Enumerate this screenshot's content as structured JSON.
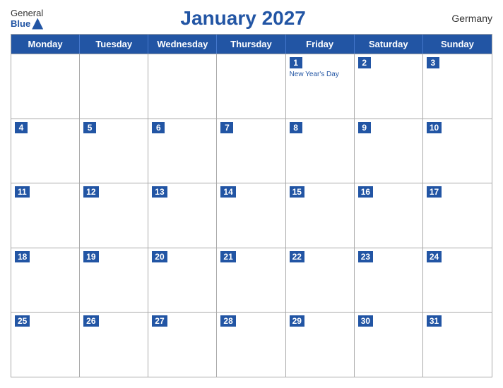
{
  "header": {
    "logo_general": "General",
    "logo_blue": "Blue",
    "title": "January 2027",
    "country": "Germany"
  },
  "days_of_week": [
    "Monday",
    "Tuesday",
    "Wednesday",
    "Thursday",
    "Friday",
    "Saturday",
    "Sunday"
  ],
  "weeks": [
    [
      {
        "num": "",
        "holiday": ""
      },
      {
        "num": "",
        "holiday": ""
      },
      {
        "num": "",
        "holiday": ""
      },
      {
        "num": "",
        "holiday": ""
      },
      {
        "num": "1",
        "holiday": "New Year's Day"
      },
      {
        "num": "2",
        "holiday": ""
      },
      {
        "num": "3",
        "holiday": ""
      }
    ],
    [
      {
        "num": "4",
        "holiday": ""
      },
      {
        "num": "5",
        "holiday": ""
      },
      {
        "num": "6",
        "holiday": ""
      },
      {
        "num": "7",
        "holiday": ""
      },
      {
        "num": "8",
        "holiday": ""
      },
      {
        "num": "9",
        "holiday": ""
      },
      {
        "num": "10",
        "holiday": ""
      }
    ],
    [
      {
        "num": "11",
        "holiday": ""
      },
      {
        "num": "12",
        "holiday": ""
      },
      {
        "num": "13",
        "holiday": ""
      },
      {
        "num": "14",
        "holiday": ""
      },
      {
        "num": "15",
        "holiday": ""
      },
      {
        "num": "16",
        "holiday": ""
      },
      {
        "num": "17",
        "holiday": ""
      }
    ],
    [
      {
        "num": "18",
        "holiday": ""
      },
      {
        "num": "19",
        "holiday": ""
      },
      {
        "num": "20",
        "holiday": ""
      },
      {
        "num": "21",
        "holiday": ""
      },
      {
        "num": "22",
        "holiday": ""
      },
      {
        "num": "23",
        "holiday": ""
      },
      {
        "num": "24",
        "holiday": ""
      }
    ],
    [
      {
        "num": "25",
        "holiday": ""
      },
      {
        "num": "26",
        "holiday": ""
      },
      {
        "num": "27",
        "holiday": ""
      },
      {
        "num": "28",
        "holiday": ""
      },
      {
        "num": "29",
        "holiday": ""
      },
      {
        "num": "30",
        "holiday": ""
      },
      {
        "num": "31",
        "holiday": ""
      }
    ]
  ]
}
